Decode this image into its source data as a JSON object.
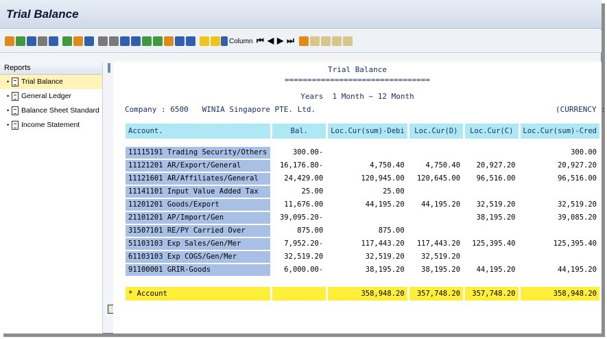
{
  "window": {
    "title": "Trial Balance"
  },
  "toolbar": {
    "column_label": "Column",
    "colors": {
      "green": "#3f9a3f",
      "blue": "#2f5fae",
      "orange": "#e08a1a",
      "yellow": "#f0c419",
      "red": "#c0392b",
      "grey": "#7a7a7a"
    }
  },
  "sidebar": {
    "header": "Reports",
    "items": [
      {
        "label": "Trial Balance",
        "selected": true
      },
      {
        "label": "General Ledger",
        "selected": false
      },
      {
        "label": "Balance Sheet Standard",
        "selected": false
      },
      {
        "label": "Income Statement",
        "selected": false
      }
    ]
  },
  "report": {
    "title": "Trial Balance",
    "underline": "================================",
    "period": "Years  1 Month ~ 12 Month",
    "company": "Company : 6500   WINIA Singapore PTE. Ltd.",
    "currency": "(CURRENCY :",
    "columns": [
      "Account.",
      "Bal.",
      "Loc.Cur(sum)-Debi",
      "Loc.Cur(D)",
      "Loc.Cur(C)",
      "Loc.Cur(sum)-Cred"
    ],
    "rows": [
      {
        "account": "11115191  Trading Security/Others",
        "bal": "300.00-",
        "sum_debit": "",
        "d": "",
        "c": "",
        "sum_credit": "300.00"
      },
      {
        "account": "11121201  AR/Export/General",
        "bal": "16,176.80-",
        "sum_debit": "4,750.40",
        "d": "4,750.40",
        "c": "20,927.20",
        "sum_credit": "20,927.20"
      },
      {
        "account": "11121601  AR/Affiliates/General",
        "bal": "24,429.00",
        "sum_debit": "120,945.00",
        "d": "120,645.00",
        "c": "96,516.00",
        "sum_credit": "96,516.00"
      },
      {
        "account": "11141101  Input Value Added Tax",
        "bal": "25.00",
        "sum_debit": "25.00",
        "d": "",
        "c": "",
        "sum_credit": ""
      },
      {
        "account": "11201201  Goods/Export",
        "bal": "11,676.00",
        "sum_debit": "44,195.20",
        "d": "44,195.20",
        "c": "32,519.20",
        "sum_credit": "32,519.20"
      },
      {
        "account": "21101201  AP/Import/Gen",
        "bal": "39,095.20-",
        "sum_debit": "",
        "d": "",
        "c": "38,195.20",
        "sum_credit": "39,085.20"
      },
      {
        "account": "31507101  RE/PY Carried Over",
        "bal": "875.00",
        "sum_debit": "875.00",
        "d": "",
        "c": "",
        "sum_credit": ""
      },
      {
        "account": "51103103  Exp Sales/Gen/Mer",
        "bal": "7,952.20-",
        "sum_debit": "117,443.20",
        "d": "117,443.20",
        "c": "125,395.40",
        "sum_credit": "125,395.40"
      },
      {
        "account": "61103103  Exp COGS/Gen/Mer",
        "bal": "32,519.20",
        "sum_debit": "32,519.20",
        "d": "32,519.20",
        "c": "",
        "sum_credit": ""
      },
      {
        "account": "91100001  GRIR-Goods",
        "bal": "6,000.00-",
        "sum_debit": "38,195.20",
        "d": "38,195.20",
        "c": "44,195.20",
        "sum_credit": "44,195.20"
      }
    ],
    "total": {
      "account": "* Account",
      "bal": "",
      "sum_debit": "358,948.20",
      "d": "357,748.20",
      "c": "357,748.20",
      "sum_credit": "358,948.20"
    }
  }
}
